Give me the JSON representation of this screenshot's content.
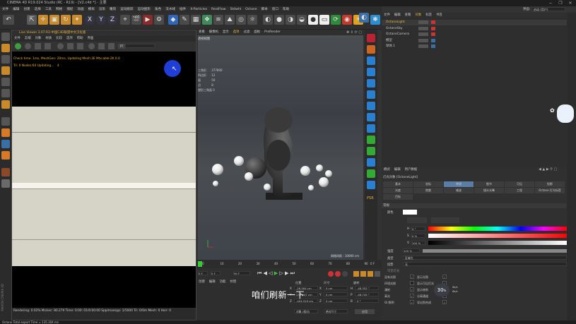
{
  "window": {
    "title": "CINEMA 4D R19.024 Studio (RC - R19) - [V2.c4d *] - 主要"
  },
  "menubar": [
    "文件",
    "编辑",
    "创建",
    "选择",
    "工具",
    "网格",
    "捕捉",
    "动画",
    "模拟",
    "渲染",
    "雕刻",
    "运动跟踪",
    "运动图形",
    "角色",
    "流水线",
    "插件",
    "X-Particles",
    "RealFlow",
    "Stdwhl",
    "Octane",
    "脚本",
    "窗口",
    "帮助"
  ],
  "layout_label": "界面:",
  "layout_value": "启动 (用户)",
  "octane": {
    "title": "Live Viewer 3.07-R2-中国C4D联盟中文汉化版",
    "menu": [
      "文件",
      "云端",
      "对象",
      "材质",
      "比较",
      "选项",
      "帮助",
      "界面"
    ],
    "pill_label": "PT",
    "console_line1": "Check time: 1ms, MeshGen: 20ms, Updating Mesh:3E Mtx:able:2K 0.0",
    "console_line2": "Tri: 0 Nodes:64 Updating...",
    "console_line2_count": "4",
    "status_text": "Rendering: 0.02% Ms/sec: 80.279 Time: 0:00: 01/0:00:00 Spp/maxspp: 1/5000 Tri: 0/0m Mesh: 0 Hair: 0"
  },
  "viewport": {
    "menu": [
      "查看",
      "摄像机",
      "显示",
      "选项",
      "过滤",
      "面板",
      "ProRender"
    ],
    "view_label": "透视视图",
    "stats_labels": [
      "三角形",
      "四边形",
      "面",
      "点",
      "塑形三角面"
    ],
    "stats_values": [
      "377800",
      "12",
      "50",
      "8",
      "0"
    ],
    "grid_label": "网格间距 : 10000 cm"
  },
  "timeline": {
    "ticks": [
      "0",
      "10",
      "20",
      "30",
      "40",
      "50",
      "60",
      "70",
      "80",
      "90"
    ],
    "frame_end": "0 F",
    "start_field": "0 F",
    "mid_field": "0 F",
    "end_field": "90 F"
  },
  "coords": {
    "menu": [
      "创建",
      "编辑",
      "功能",
      "纹理"
    ],
    "headers": [
      "位置",
      "尺寸",
      "旋转"
    ],
    "rows": [
      {
        "axis": "X",
        "pos": "-26.564 cm",
        "size": "0 cm",
        "rot_label": "H",
        "rot": "-48.352 °"
      },
      {
        "axis": "Y",
        "pos": "230.947 cm",
        "size": "0 cm",
        "rot_label": "P",
        "rot": "-48.745 °"
      },
      {
        "axis": "Z",
        "pos": "-404.519 cm",
        "size": "0 cm",
        "rot_label": "B",
        "rot": "0 °"
      }
    ],
    "mode1": "对象 (相对)",
    "mode2": "绝对尺寸",
    "apply": "应用"
  },
  "subtitle": "咱们刷新一下",
  "objects": {
    "tabs": [
      "文件",
      "编辑",
      "查看",
      "对象",
      "标签",
      "书签"
    ],
    "rows": [
      {
        "name": "OctaneLight",
        "selected": true
      },
      {
        "name": "OctaneSky",
        "selected": false
      },
      {
        "name": "OctaneCamera",
        "selected": false
      },
      {
        "name": "模型",
        "selected": false
      },
      {
        "name": "球体.1",
        "selected": false
      }
    ]
  },
  "attributes": {
    "menu": [
      "模式",
      "编辑",
      "用户数据"
    ],
    "object_title": "灯光对象 [OctaneLight]",
    "tabs_row1": [
      "基本",
      "坐标",
      "常规",
      "细节",
      "可见",
      "投影"
    ],
    "tabs_row2": [
      "光度",
      "焦散",
      "噪波",
      "镜头光晕",
      "工程",
      "Octane 灯光标签"
    ],
    "tabs_row3": [
      "目标"
    ],
    "section": "常规",
    "color_label": "颜色",
    "h_label": "H",
    "h_value": "0 °",
    "s_label": "S",
    "s_value": "0 %",
    "v_label": "V",
    "v_value": "100 %",
    "intensity_label": "强度",
    "intensity_value": "100 %",
    "type_label": "类型",
    "type_value": "区域光",
    "shadow_label": "投影",
    "shadow_value": "无",
    "visible_label": "可见灯光",
    "checks": [
      {
        "label": "没有光照",
        "value": "✓"
      },
      {
        "label": "显示光照",
        "value": "✓"
      },
      {
        "label": "环境光照",
        "value": ""
      },
      {
        "label": "显示可见灯光",
        "value": "✓"
      },
      {
        "label": "漫射",
        "value": "✓"
      },
      {
        "label": "显示修剪",
        "value": "✓"
      },
      {
        "label": "高光",
        "value": "✓"
      },
      {
        "label": "分离通道",
        "value": ""
      },
      {
        "label": "GI 照明",
        "value": "✓"
      },
      {
        "label": "导出到合成",
        "value": "✓"
      }
    ]
  },
  "badge": {
    "percent": "30",
    "unit": "%",
    "up": "0k/s",
    "down": "0k/s"
  },
  "pathbar": "Octane Total export Time = 135.304 ms",
  "colors": {
    "accent": "#3a6ea5",
    "octane_orange": "#e8b23a",
    "hue_start": "#ff0000"
  }
}
